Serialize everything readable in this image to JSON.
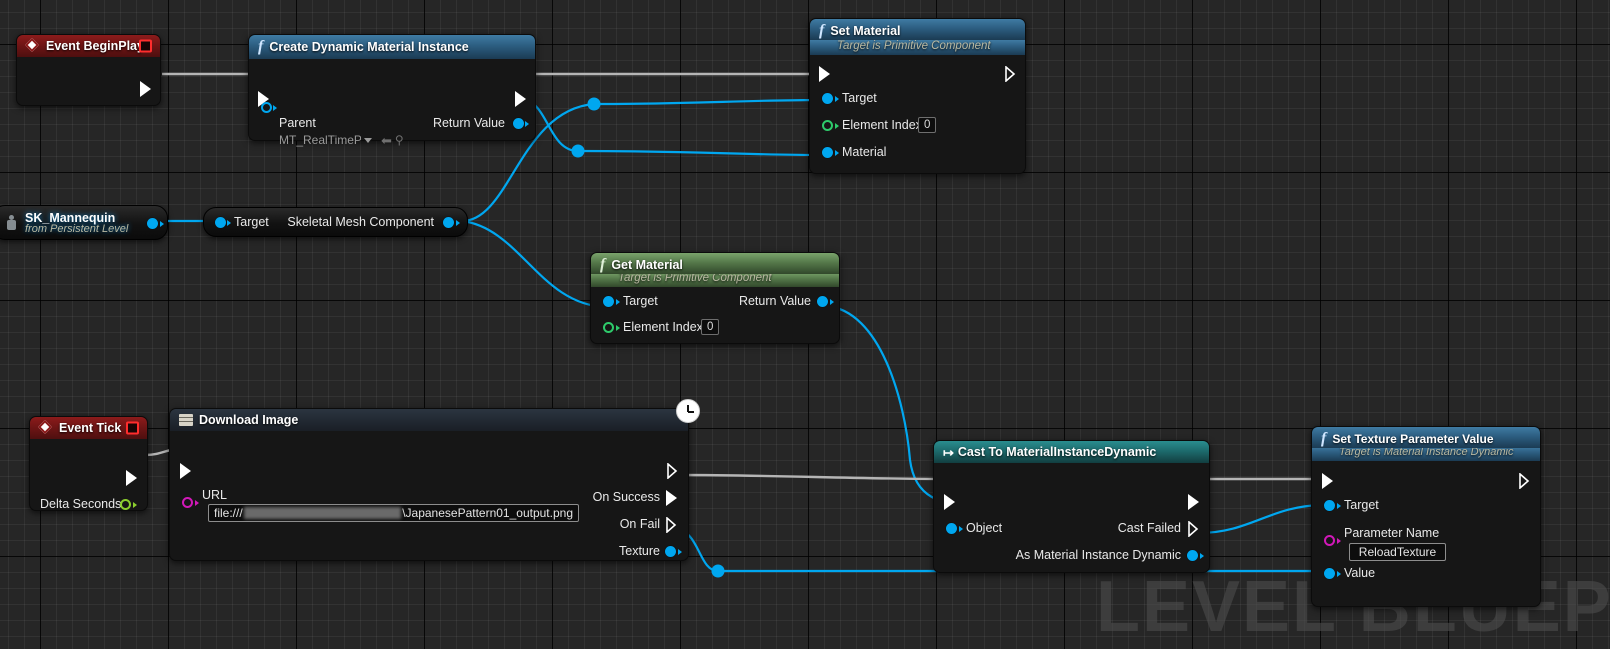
{
  "editor": {
    "watermark": "LEVEL BLUEPRINT"
  },
  "nodes": {
    "event_begin_play": {
      "title": "Event BeginPlay",
      "icon": "event-diamond-icon",
      "stop_icon": "stop-square-icon"
    },
    "create_dynamic_material_instance": {
      "title": "Create Dynamic Material Instance",
      "icon": "function-f-icon",
      "in_pins": [
        {
          "label": "Parent",
          "value": "MT_RealTimePre",
          "type": "object"
        }
      ],
      "out_pins": [
        {
          "label": "Return Value",
          "type": "object"
        }
      ]
    },
    "set_material": {
      "title": "Set Material",
      "subtitle": "Target is Primitive Component",
      "icon": "function-f-icon",
      "in_pins": [
        {
          "label": "Target",
          "type": "object"
        },
        {
          "label": "Element Index",
          "type": "int",
          "value": "0"
        },
        {
          "label": "Material",
          "type": "object"
        }
      ]
    },
    "sk_mannequin": {
      "title": "SK_Mannequin",
      "subtitle": "from Persistent Level",
      "icon": "actor-icon"
    },
    "skeletal_mesh_component": {
      "in_label": "Target",
      "out_label": "Skeletal Mesh Component"
    },
    "get_material": {
      "title": "Get Material",
      "subtitle": "Target is Primitive Component",
      "icon": "function-f-icon",
      "in_pins": [
        {
          "label": "Target",
          "type": "object"
        },
        {
          "label": "Element Index",
          "type": "int",
          "value": "0"
        }
      ],
      "out_pins": [
        {
          "label": "Return Value",
          "type": "object"
        }
      ]
    },
    "event_tick": {
      "title": "Event Tick",
      "icon": "event-diamond-icon",
      "stop_icon": "stop-square-icon",
      "out_pins": [
        {
          "label": "Delta Seconds",
          "type": "float"
        }
      ]
    },
    "download_image": {
      "title": "Download Image",
      "icon": "download-image-icon",
      "latent_icon": "clock-icon",
      "in_pins": [
        {
          "label": "URL",
          "type": "string",
          "value_prefix": "file:///",
          "value_suffix": "\\JapanesePattern01_output.png",
          "value_redacted": true
        }
      ],
      "out_pins": [
        {
          "label": "On Success",
          "type": "exec"
        },
        {
          "label": "On Fail",
          "type": "exec"
        },
        {
          "label": "Texture",
          "type": "object"
        }
      ]
    },
    "cast_to_material_instance_dynamic": {
      "title": "Cast To MaterialInstanceDynamic",
      "icon": "cast-arrow-icon",
      "in_pins": [
        {
          "label": "Object",
          "type": "object"
        }
      ],
      "out_pins": [
        {
          "label": "Cast Failed",
          "type": "exec"
        },
        {
          "label": "As Material Instance Dynamic",
          "type": "object"
        }
      ]
    },
    "set_texture_parameter_value": {
      "title": "Set Texture Parameter Value",
      "subtitle": "Target is Material Instance Dynamic",
      "icon": "function-f-icon",
      "in_pins": [
        {
          "label": "Target",
          "type": "object"
        },
        {
          "label": "Parameter Name",
          "type": "name",
          "value": "ReloadTexture"
        },
        {
          "label": "Value",
          "type": "object"
        }
      ]
    }
  },
  "colors": {
    "exec_wire": "#b5b5b5",
    "object_wire": "#00a7f0",
    "object_pin": "#00a7f0",
    "int_pin": "#2ecb6b",
    "float_pin": "#8ccf2e",
    "name_pin": "#d118b8",
    "string_pin": "#d118b8",
    "event_header": "#8c1b1b",
    "function_header": "#2c5d80",
    "pure_header": "#55794a",
    "cast_header": "#1d6b6d",
    "canvas_bg": "#262626"
  }
}
